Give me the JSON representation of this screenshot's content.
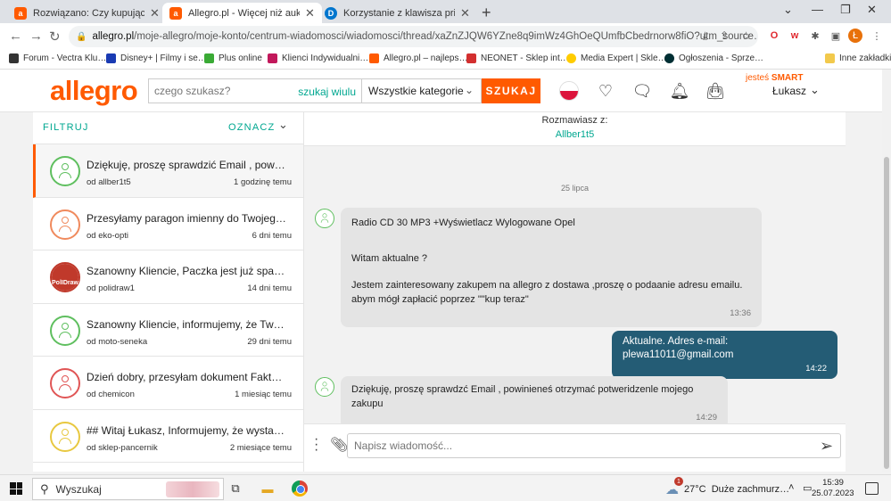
{
  "browser": {
    "tabs": [
      {
        "title": "Rozwiązano: Czy kupujący potrze…",
        "favicon": "allegro-a-icon",
        "favicon_color": "#ff5a00",
        "active": false
      },
      {
        "title": "Allegro.pl - Więcej niż aukcje. Na…",
        "favicon": "allegro-a-icon",
        "favicon_color": "#ff5a00",
        "active": true
      },
      {
        "title": "Korzystanie z klawisza print scre…",
        "favicon": "dell-icon",
        "favicon_color": "#0076ce",
        "active": false
      }
    ],
    "new_tab": "+",
    "url_host": "allegro.pl",
    "url_path": "/moje-allegro/moje-konto/centrum-wiadomosci/wiadomosci/thread/xaZnZJQW6YZne8q9imWz4GhOeQUmfbCbedrnorw8fiO?utm_source…",
    "profile_initial": "Ł"
  },
  "bookmarks": [
    {
      "label": "Forum - Vectra Klu…",
      "color": "#333333"
    },
    {
      "label": "Disney+ | Filmy i se…",
      "color": "#1a3bb3"
    },
    {
      "label": "Plus online",
      "color": "#3aaa35"
    },
    {
      "label": "Klienci Indywidualni…",
      "color": "#c2185b"
    },
    {
      "label": "Allegro.pl – najleps…",
      "color": "#ff5a00"
    },
    {
      "label": "NEONET - Sklep int…",
      "color": "#d32f2f"
    },
    {
      "label": "Media Expert | Skle…",
      "color": "#ffcc00"
    },
    {
      "label": "Ogłoszenia - Sprze…",
      "color": "#002f34"
    }
  ],
  "bookmarks_other": "Inne zakładki",
  "allegro": {
    "logo": "allegro",
    "search_placeholder": "czego szukasz?",
    "search_in_desc": "szukaj wiulu",
    "category": "Wszystkie kategorie",
    "search_button": "SZUKAJ",
    "smart_label_prefix": "jesteś",
    "smart_label": "SMART",
    "user_name": "Łukasz",
    "colors": {
      "brand": "#ff5a00",
      "teal": "#00a790",
      "outgoing_bubble": "#245c75"
    }
  },
  "filters": {
    "filter_label": "FILTRUJ",
    "mark_label": "OZNACZ"
  },
  "threads": [
    {
      "subject": "Dziękuję, proszę sprawdzić Email , powinie…",
      "from": "od allber1t5",
      "time": "1 godzinę temu",
      "avatar": "user",
      "color": "#5fbf5f",
      "selected": true
    },
    {
      "subject": "Przesyłamy paragon imienny do Twojego …",
      "from": "od eko-opti",
      "time": "6 dni temu",
      "avatar": "user",
      "color": "#f08a5d",
      "selected": false
    },
    {
      "subject": "Szanowny Kliencie, Paczka jest już spakow…",
      "from": "od polidraw1",
      "time": "14 dni temu",
      "avatar": "logo",
      "color": "#c0392b",
      "logo_text": "PolIDraw",
      "selected": false
    },
    {
      "subject": "Szanowny Kliencie, informujemy, że Twoje…",
      "from": "od moto-seneka",
      "time": "29 dni temu",
      "avatar": "user",
      "color": "#5fbf5f",
      "selected": false
    },
    {
      "subject": "Dzień dobry, przesyłam dokument Faktur…",
      "from": "od chemicon",
      "time": "1 miesiąc temu",
      "avatar": "user",
      "color": "#e05555",
      "selected": false
    },
    {
      "subject": "## Witaj Łukasz, Informujemy, że wystawi…",
      "from": "od sklep-pancernik",
      "time": "2 miesiące temu",
      "avatar": "user",
      "color": "#e8c840",
      "selected": false
    }
  ],
  "chat": {
    "talking_to_label": "Rozmawiasz z:",
    "partner": "Allber1t5",
    "day": "25 lipca",
    "messages": [
      {
        "dir": "in",
        "lines": [
          "Radio CD 30 MP3 +Wyświetlacz Wylogowane Opel",
          "",
          "",
          "Witam aktualne ?",
          "",
          "Jestem zainteresowany zakupem na allegro z dostawa ,proszę o podaanie adresu emailu.",
          "abym mógł zapłacić poprzez \"\"kup teraz\""
        ],
        "time": "13:36"
      },
      {
        "dir": "out",
        "lines": [
          "Aktualne. Adres e-mail: plewa11011@gmail.com"
        ],
        "time": "14:22"
      },
      {
        "dir": "in",
        "lines": [
          "Dziękuję, proszę sprawdzć Email , powinieneś otrzymać potweridzenle mojego zakupu"
        ],
        "time": "14:29"
      }
    ],
    "composer_placeholder": "Napisz wiadomość..."
  },
  "taskbar": {
    "search_placeholder": "Wyszukaj",
    "weather_temp": "27°C",
    "weather_desc": "Duże zachmurz…",
    "weather_badge": "1",
    "time": "15:39",
    "date": "25.07.2023"
  }
}
